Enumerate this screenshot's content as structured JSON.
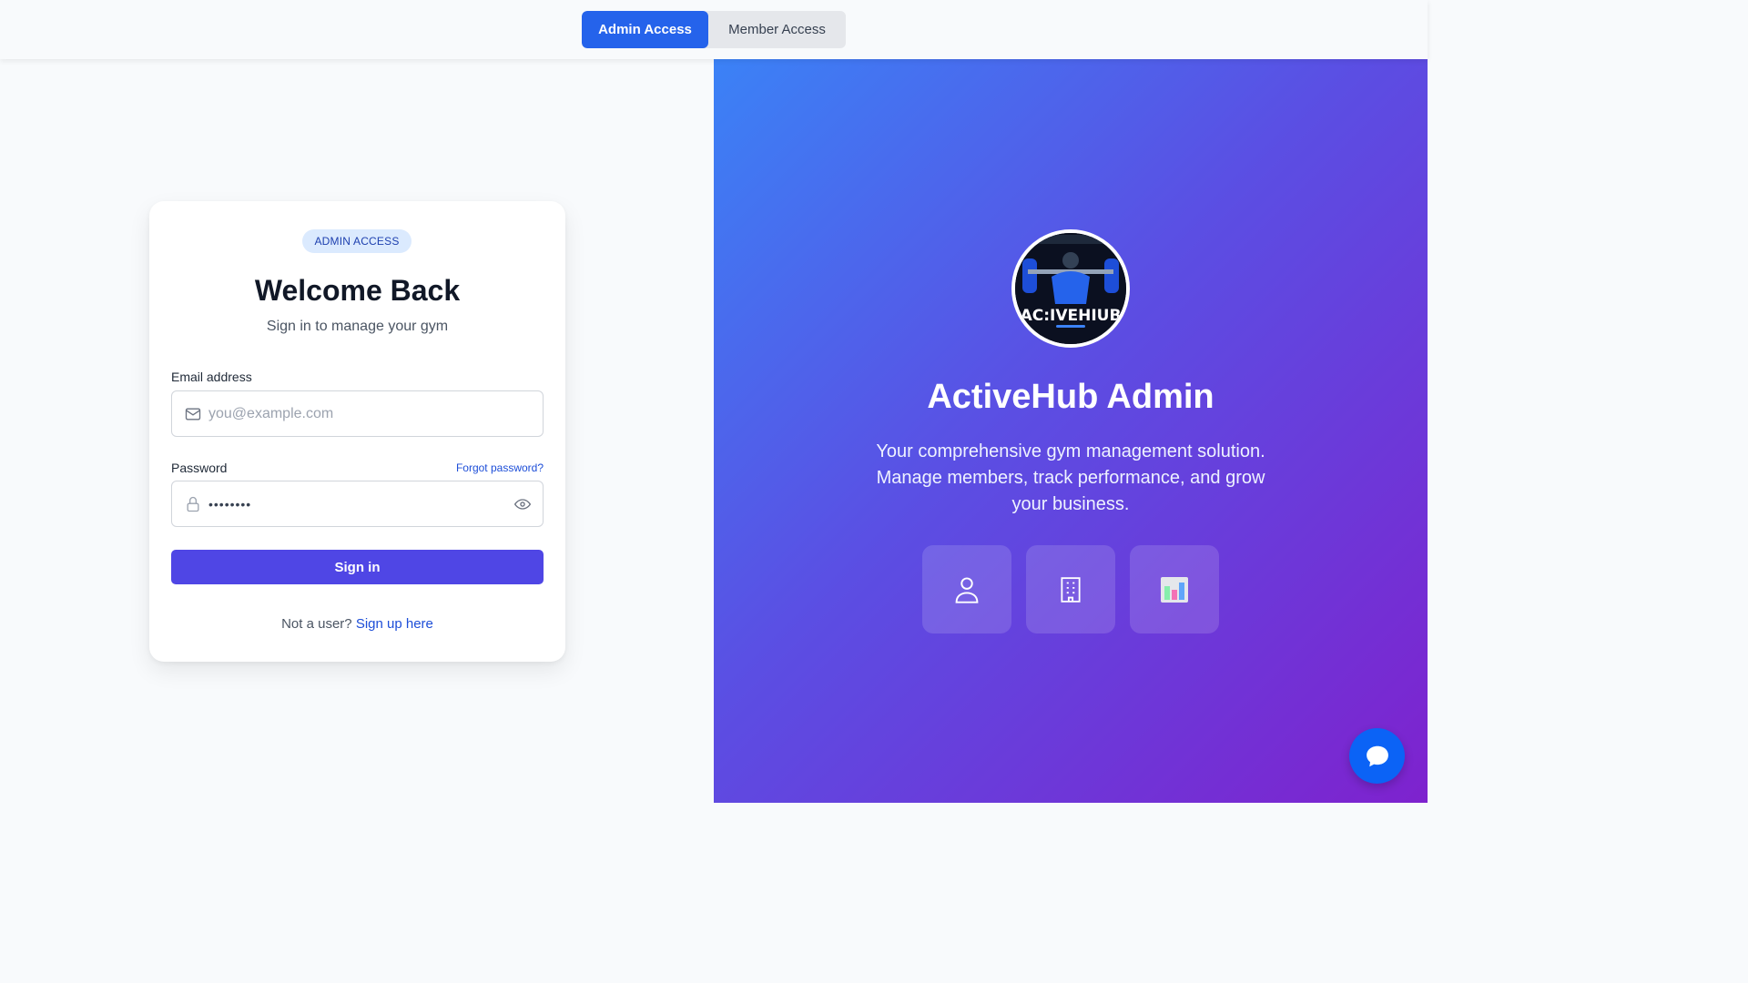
{
  "top_tabs": {
    "admin": "Admin Access",
    "member": "Member Access",
    "active": "admin"
  },
  "login_card": {
    "badge": "ADMIN ACCESS",
    "title": "Welcome Back",
    "subtitle": "Sign in to manage your gym",
    "email": {
      "label": "Email address",
      "placeholder": "you@example.com",
      "icon": "mail-icon"
    },
    "password": {
      "label": "Password",
      "value": "••••••••",
      "icon": "lock-icon",
      "toggle_icon": "eye-icon"
    },
    "forgot_link": "Forgot password?",
    "submit_label": "Sign in",
    "signup_prompt": "Not a user?",
    "signup_link": "Sign up here"
  },
  "brand_panel": {
    "logo_text": "AC:IVEHIUB",
    "title": "ActiveHub Admin",
    "description": "Your comprehensive gym management solution. Manage members, track performance, and grow your business.",
    "feature_icons": [
      "user-icon",
      "building-icon",
      "chart-icon"
    ]
  },
  "colors": {
    "primary": "#2563eb",
    "signin": "#4f46e5",
    "gradient_start": "#3b82f6",
    "gradient_end": "#7e22ce",
    "chat": "#0b63f6"
  },
  "chat_widget": {
    "icon": "chat-bubble-icon"
  }
}
